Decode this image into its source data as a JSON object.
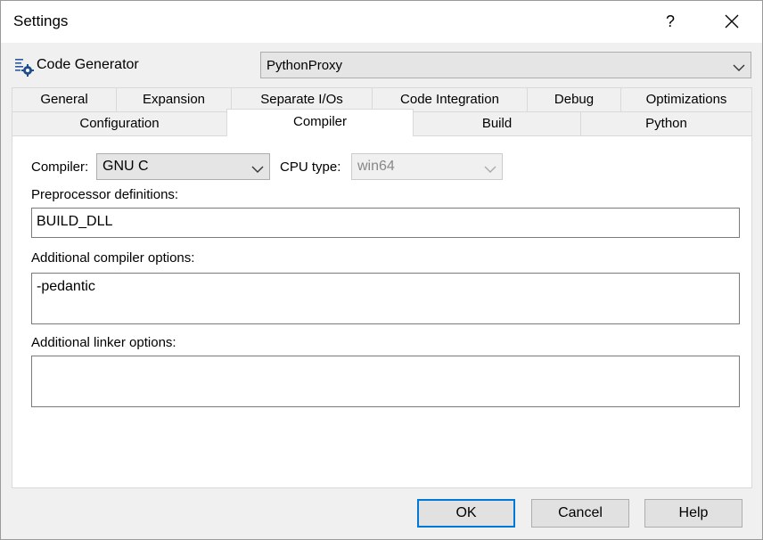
{
  "window": {
    "title": "Settings",
    "help_label": "?"
  },
  "generator": {
    "label": "Code Generator",
    "icon": "code-generator-icon",
    "selected": "PythonProxy"
  },
  "tabs": {
    "row1": [
      "General",
      "Expansion",
      "Separate I/Os",
      "Code Integration",
      "Debug",
      "Optimizations"
    ],
    "row2": [
      "Configuration",
      "Compiler",
      "Build",
      "Python"
    ],
    "active": "Compiler"
  },
  "compiler_page": {
    "compiler_label": "Compiler:",
    "compiler_value": "GNU C",
    "cpu_label": "CPU type:",
    "cpu_value": "win64",
    "preproc_label": "Preprocessor definitions:",
    "preproc_value": "BUILD_DLL",
    "addcomp_label": "Additional compiler options:",
    "addcomp_value": "-pedantic",
    "addlink_label": "Additional linker options:",
    "addlink_value": ""
  },
  "buttons": {
    "ok": "OK",
    "cancel": "Cancel",
    "help": "Help"
  },
  "colors": {
    "accent": "#0078d7",
    "dialog_bg": "#f0f0f0"
  }
}
